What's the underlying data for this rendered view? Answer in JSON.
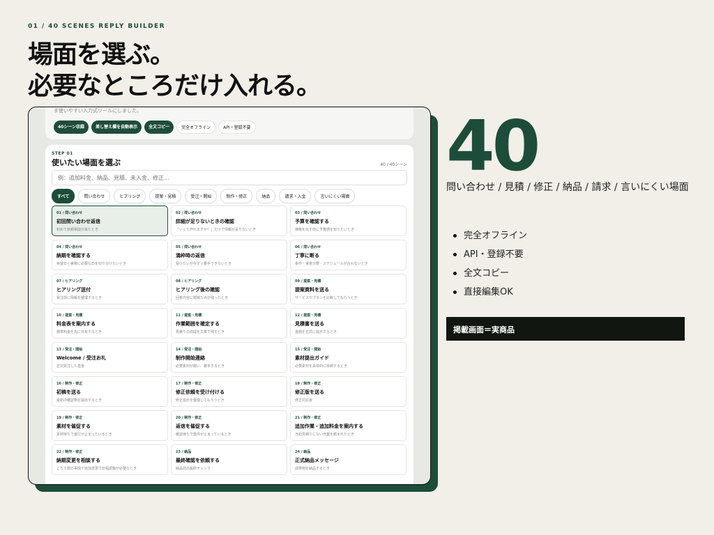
{
  "eyebrow": "01 / 40 SCENES REPLY BUILDER",
  "headline": {
    "line1": "場面を選ぶ。",
    "line2": "必要なところだけ入れる。"
  },
  "app": {
    "intro_desc": "ま使いやすい入力式ツールにしました。",
    "feature_chips": [
      {
        "label": "40シーン収録",
        "style": "dark"
      },
      {
        "label": "差し替え欄を自動表示",
        "style": "dark"
      },
      {
        "label": "全文コピー",
        "style": "dark"
      },
      {
        "label": "完全オフライン",
        "style": "light"
      },
      {
        "label": "API・登録不要",
        "style": "light"
      }
    ],
    "step_label": "STEP 01",
    "panel_title": "使いたい場面を選ぶ",
    "scene_count": "40 / 40シーン",
    "search_placeholder": "例：追加料金、納品、見積、未入金、修正...",
    "filters": [
      "すべて",
      "問い合わせ",
      "ヒアリング",
      "提案・見積",
      "受注・開始",
      "制作・修正",
      "納品",
      "請求・入金",
      "言いにくい場面"
    ],
    "active_filter": "すべて",
    "cards": [
      {
        "cat": "01 / 問い合わせ",
        "title": "初回問い合わせ返信",
        "desc": "初めて依頼相談が来たとき",
        "selected": true
      },
      {
        "cat": "02 / 問い合わせ",
        "title": "詳細が足りないときの確認",
        "desc": "「いくら作れますか？」だけで情報が足りないとき"
      },
      {
        "cat": "03 / 問い合わせ",
        "title": "予算を確認する",
        "desc": "価格を出す前に予算感を知りたいとき"
      },
      {
        "cat": "04 / 問い合わせ",
        "title": "納期を確認する",
        "desc": "希望日と実際に必要な日を切り分けたいとき"
      },
      {
        "cat": "05 / 問い合わせ",
        "title": "満枠時の返信",
        "desc": "受けたいが今すぐ着手できないとき"
      },
      {
        "cat": "06 / 問い合わせ",
        "title": "丁寧に断る",
        "desc": "条件・得意分野・スケジュールが合わないとき"
      },
      {
        "cat": "07 / ヒアリング",
        "title": "ヒアリング送付",
        "desc": "受注前に情報を整理するとき"
      },
      {
        "cat": "08 / ヒアリング",
        "title": "ヒアリング後の確認",
        "desc": "回答内容に曖昧な点が残ったとき"
      },
      {
        "cat": "09 / 提案・見積",
        "title": "提案資料を送る",
        "desc": "サービスやプランを比較してもらうとき"
      },
      {
        "cat": "10 / 提案・見積",
        "title": "料金表を案内する",
        "desc": "標準料金を先に共有するとき"
      },
      {
        "cat": "11 / 提案・見積",
        "title": "作業範囲を確定する",
        "desc": "見積りの前提を文章で残すとき"
      },
      {
        "cat": "12 / 提案・見積",
        "title": "見積書を送る",
        "desc": "金額を正式に提示するとき"
      },
      {
        "cat": "13 / 受注・開始",
        "title": "Welcome / 受注お礼",
        "desc": "正式受注した直後"
      },
      {
        "cat": "14 / 受注・開始",
        "title": "制作開始連絡",
        "desc": "必要素材が揃い、着手するとき"
      },
      {
        "cat": "15 / 受注・開始",
        "title": "素材提出ガイド",
        "desc": "必要素材を具体的に依頼するとき"
      },
      {
        "cat": "16 / 制作・修正",
        "title": "初稿を送る",
        "desc": "最初の確認物を提出するとき"
      },
      {
        "cat": "17 / 制作・修正",
        "title": "修正依頼を受け付ける",
        "desc": "修正指示を整理してもらうとき"
      },
      {
        "cat": "18 / 制作・修正",
        "title": "修正版を送る",
        "desc": "修正対応後"
      },
      {
        "cat": "19 / 制作・修正",
        "title": "素材を催促する",
        "desc": "素材待ちで進行が止まっているとき"
      },
      {
        "cat": "20 / 制作・修正",
        "title": "返信を催促する",
        "desc": "確認待ちで案件が止まっているとき"
      },
      {
        "cat": "21 / 制作・修正",
        "title": "追加作業・追加料金を案内する",
        "desc": "当初見積りにない作業を頼まれたとき"
      },
      {
        "cat": "22 / 制作・修正",
        "title": "納期変更を相談する",
        "desc": "こちら側の事情や追加変更で日程調整が必要なとき"
      },
      {
        "cat": "23 / 納品",
        "title": "最終確認を依頼する",
        "desc": "納品前の最終チェック"
      },
      {
        "cat": "24 / 納品",
        "title": "正式納品メッセージ",
        "desc": "成果物を納品するとき"
      }
    ]
  },
  "side": {
    "big_number": "40",
    "scenes_text": "問い合わせ / 見積 / 修正 / 納品 / 請求 / 言いにくい場面",
    "bullets": [
      "完全オフライン",
      "API・登録不要",
      "全文コピー",
      "直接編集OK"
    ],
    "banner": "掲載画面＝実商品"
  },
  "colors": {
    "accent": "#1d4d3a",
    "background": "#f1efe8",
    "banner_bg": "#111611"
  }
}
